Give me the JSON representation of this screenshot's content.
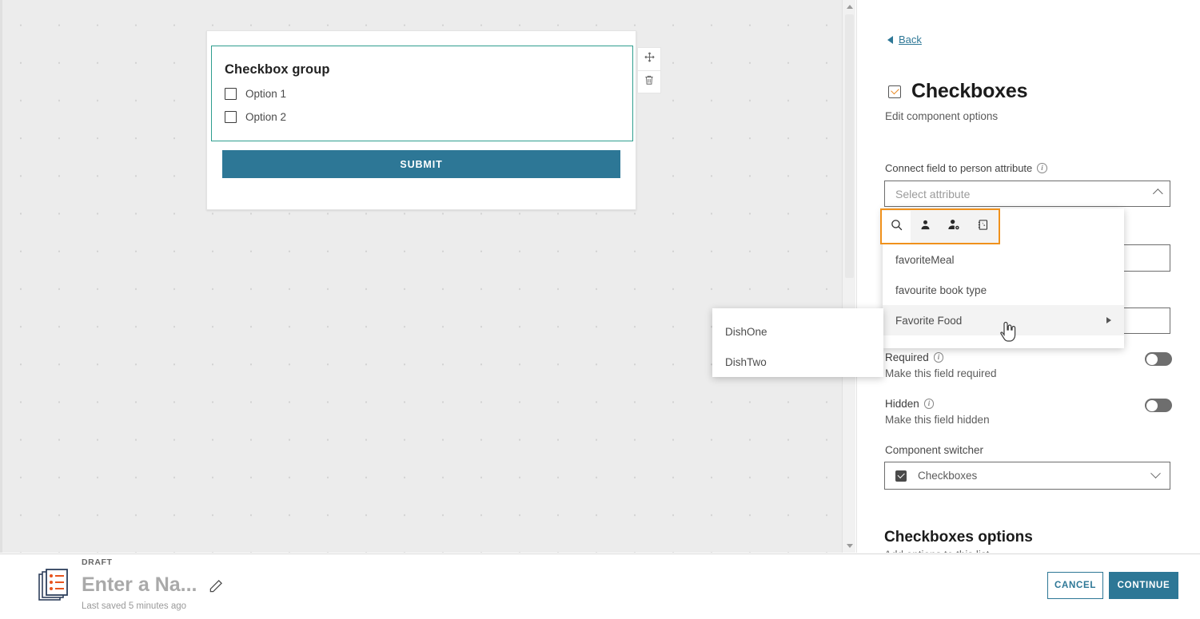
{
  "canvas": {
    "component": {
      "title": "Checkbox group",
      "options": [
        {
          "label": "Option 1"
        },
        {
          "label": "Option 2"
        }
      ]
    },
    "submit_label": "SUBMIT",
    "actions": [
      {
        "name": "move-icon"
      },
      {
        "name": "delete-icon"
      }
    ]
  },
  "panel": {
    "back_label": "Back",
    "title": "Checkboxes",
    "subtitle": "Edit component options",
    "attribute_field": {
      "label": "Connect field to person attribute",
      "placeholder": "Select attribute",
      "tabs": [
        {
          "name": "search-icon",
          "active": true
        },
        {
          "name": "person-icon",
          "active": false
        },
        {
          "name": "person-settings-icon",
          "active": false
        },
        {
          "name": "contact-card-icon",
          "active": false
        }
      ],
      "items": [
        {
          "label": "favoriteMeal",
          "has_submenu": false,
          "hovered": false
        },
        {
          "label": "favourite book type",
          "has_submenu": false,
          "hovered": false
        },
        {
          "label": "Favorite Food",
          "has_submenu": true,
          "hovered": true
        }
      ],
      "submenu": [
        {
          "label": "DishOne"
        },
        {
          "label": "DishTwo"
        }
      ]
    },
    "required": {
      "label": "Required",
      "description": "Make this field required",
      "on": false
    },
    "hidden": {
      "label": "Hidden",
      "description": "Make this field hidden",
      "on": false
    },
    "component_switcher": {
      "label": "Component switcher",
      "value": "Checkboxes"
    },
    "options_section": {
      "heading": "Checkboxes options",
      "subtext": "Add options to this list"
    }
  },
  "bottombar": {
    "status": "DRAFT",
    "form_name": "Enter a Na...",
    "last_saved": "Last saved 5 minutes ago",
    "cancel_label": "CANCEL",
    "continue_label": "CONTINUE"
  },
  "colors": {
    "accent_blue": "#2d7796",
    "selected_green": "#2f9e8f",
    "focus_orange": "#f0911c"
  }
}
